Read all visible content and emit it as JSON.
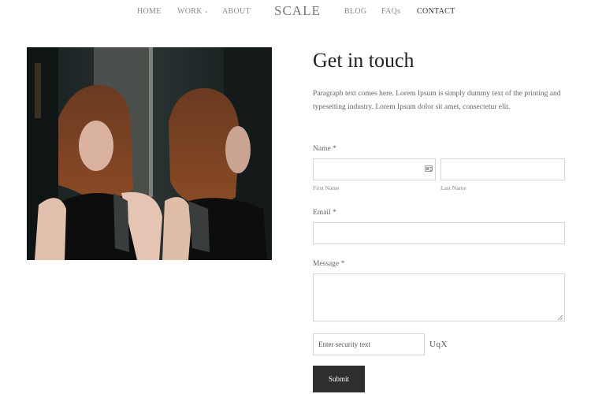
{
  "nav": {
    "home": "HOME",
    "work": "WORK",
    "about": "ABOUT",
    "logo": "SCALE",
    "blog": "BLOG",
    "faqs": "FAQs",
    "contact": "CONTACT",
    "active": "CONTACT"
  },
  "main": {
    "heading": "Get in touch",
    "paragraph": "Paragraph text comes here. Lorem Ipsum is simply dummy text of the printing and typesetting industry. Lorem Ipsum dolor sit amet, consectetur elit."
  },
  "form": {
    "name_label": "Name *",
    "first_name_sublabel": "First Name",
    "last_name_sublabel": "Last Name",
    "first_name_value": "",
    "last_name_value": "",
    "email_label": "Email *",
    "email_value": "",
    "message_label": "Message *",
    "message_value": "",
    "security_placeholder": "Enter security text",
    "captcha_text": "UqX",
    "submit_label": "Submit"
  },
  "icons": {
    "nav_dropdown": "chevron-down-icon",
    "first_name_field": "contact-card-icon",
    "message_field": "resize-grip-icon"
  },
  "colors": {
    "submit_bg": "#2f2f2f",
    "nav_inactive": "#8a8a8a",
    "nav_active": "#333333"
  }
}
